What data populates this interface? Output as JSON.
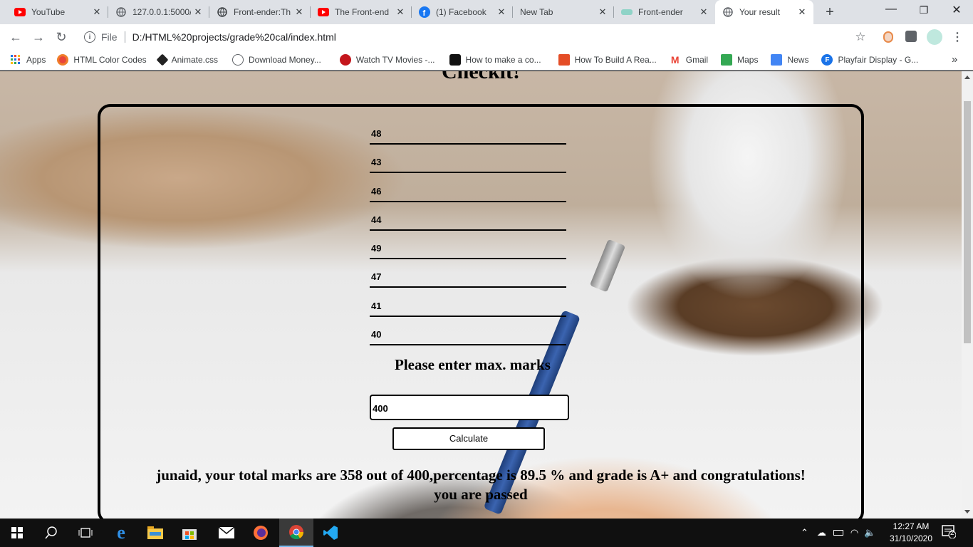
{
  "browser": {
    "tabs": [
      {
        "title": "YouTube",
        "icon": "youtube-icon"
      },
      {
        "title": "127.0.0.1:5000/",
        "icon": "globe-icon"
      },
      {
        "title": "Front-ender:Th",
        "icon": "globe-icon"
      },
      {
        "title": "The Front-end",
        "icon": "youtube-icon"
      },
      {
        "title": "(1) Facebook",
        "icon": "facebook-icon"
      },
      {
        "title": "New Tab",
        "icon": "none"
      },
      {
        "title": "Front-ender",
        "icon": "frontender-icon"
      },
      {
        "title": "Your result",
        "icon": "globe-icon",
        "active": true
      }
    ],
    "new_tab_symbol": "+",
    "window_controls": {
      "minimize": "—",
      "restore": "❐",
      "close": "✕"
    },
    "address": {
      "scheme_label": "File",
      "url": "D:/HTML%20projects/grade%20cal/index.html"
    },
    "bookmarks": [
      {
        "label": "Apps",
        "icon": "apps-grid-icon"
      },
      {
        "label": "HTML Color Codes",
        "icon": "color-wheel-icon"
      },
      {
        "label": "Animate.css",
        "icon": "animate-icon"
      },
      {
        "label": "Download Money...",
        "icon": "globe-icon"
      },
      {
        "label": "Watch TV Movies -...",
        "icon": "tv-icon"
      },
      {
        "label": "How to make a co...",
        "icon": "code-icon"
      },
      {
        "label": "How To Build A Rea...",
        "icon": "bookmark-icon"
      },
      {
        "label": "Gmail",
        "icon": "gmail-icon"
      },
      {
        "label": "Maps",
        "icon": "maps-icon"
      },
      {
        "label": "News",
        "icon": "news-icon"
      },
      {
        "label": "Playfair Display - G...",
        "icon": "fonts-icon"
      }
    ],
    "bookmarks_overflow": "»"
  },
  "page": {
    "heading": "Checkit!",
    "marks": [
      "48",
      "43",
      "46",
      "44",
      "49",
      "47",
      "41",
      "40"
    ],
    "max_label": "Please enter max. marks",
    "max_value": "400",
    "calculate_label": "Calculate",
    "result_line1": "junaid, your total marks are 358 out of 400,percentage is 89.5 % and grade is A+ and congratulations!",
    "result_line2": "you are passed"
  },
  "taskbar": {
    "clock_time": "12:27 AM",
    "clock_date": "31/10/2020",
    "notification_count": "2"
  },
  "colors": {
    "accent": "#76b9ed",
    "youtube": "#ff0000",
    "facebook": "#1877f2"
  }
}
